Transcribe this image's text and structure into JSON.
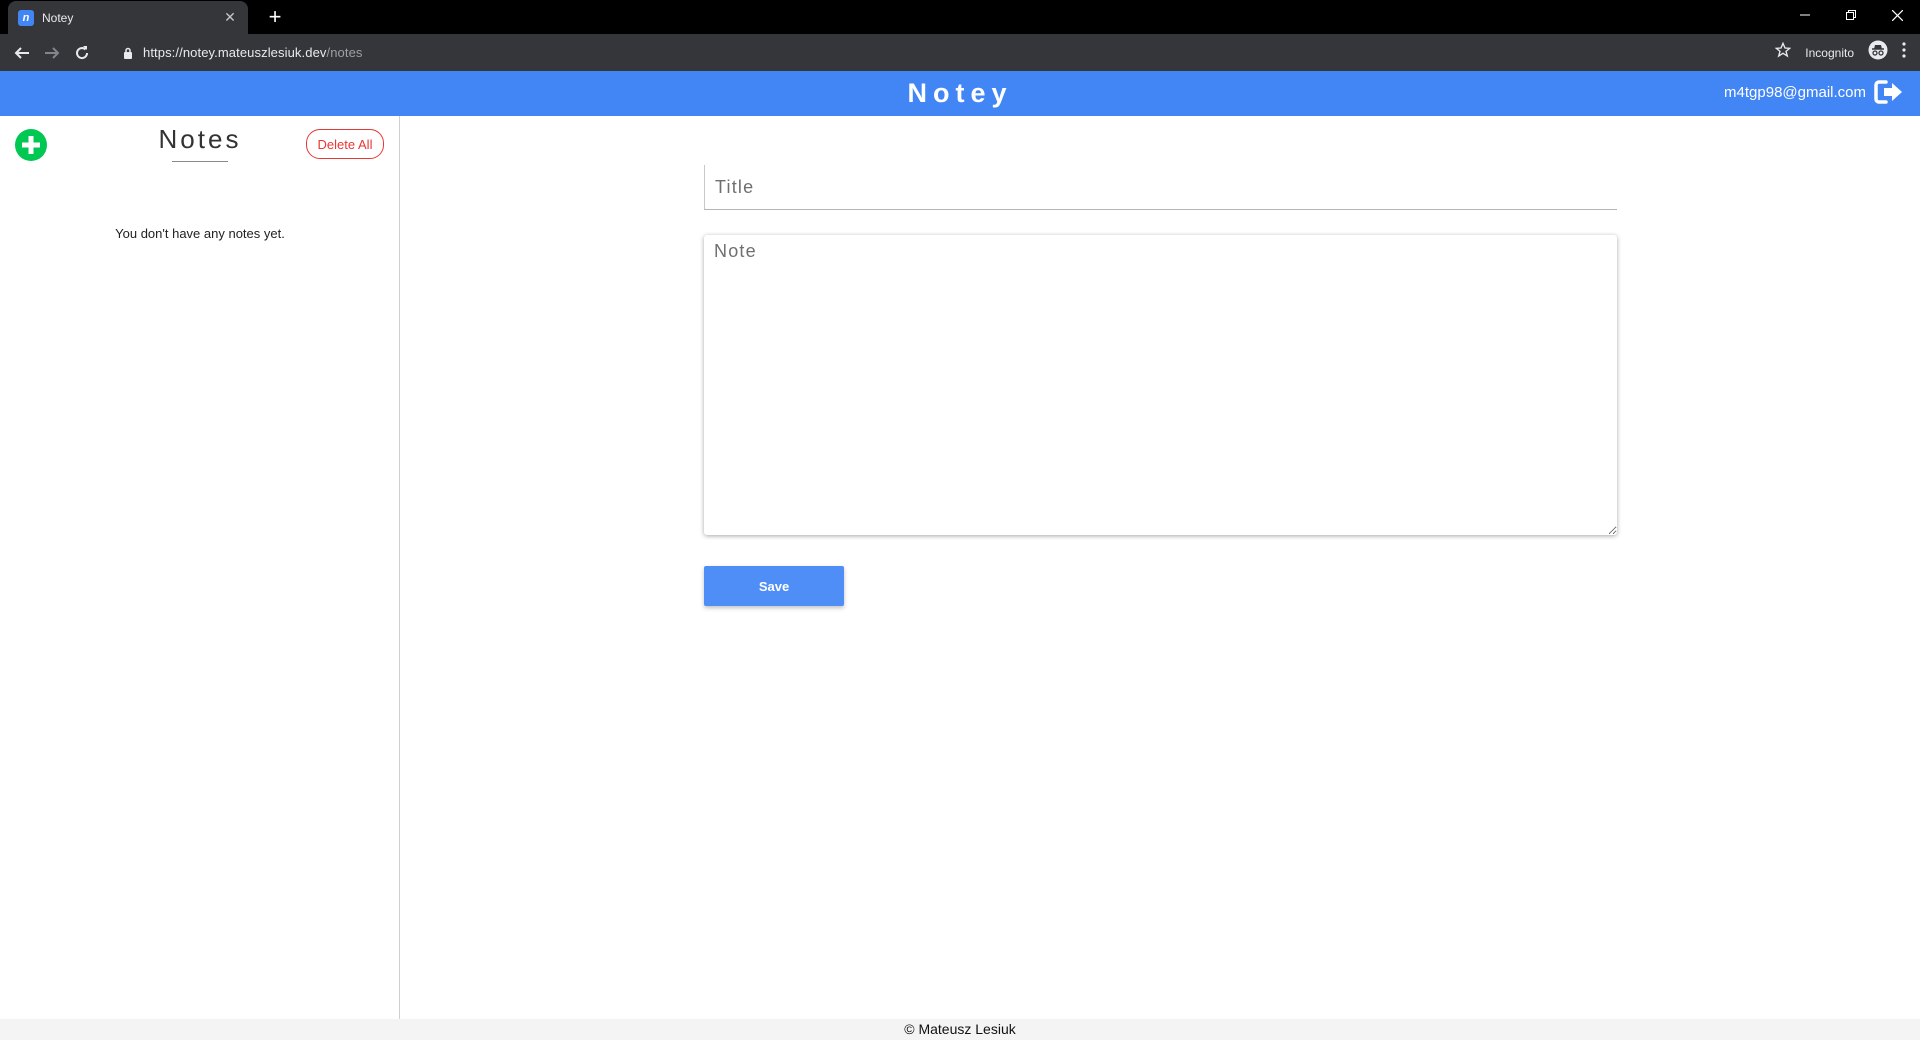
{
  "browser": {
    "tab_title": "Notey",
    "tab_favicon": "notey-favicon",
    "url_host": "https://notey.mateuszlesiuk.dev",
    "url_path": "/notes",
    "incognito_label": "Incognito"
  },
  "app": {
    "brand": "Notey",
    "user_email": "m4tgp98@gmail.com",
    "header_color": "#4285f4"
  },
  "sidebar": {
    "title": "Notes",
    "delete_all_label": "Delete All",
    "empty_message": "You don't have any notes yet.",
    "add_icon": "plus-circle-icon",
    "add_color": "#00c853"
  },
  "editor": {
    "title_placeholder": "Title",
    "note_placeholder": "Note",
    "save_label": "Save"
  },
  "footer": {
    "text": "© Mateusz Lesiuk"
  }
}
